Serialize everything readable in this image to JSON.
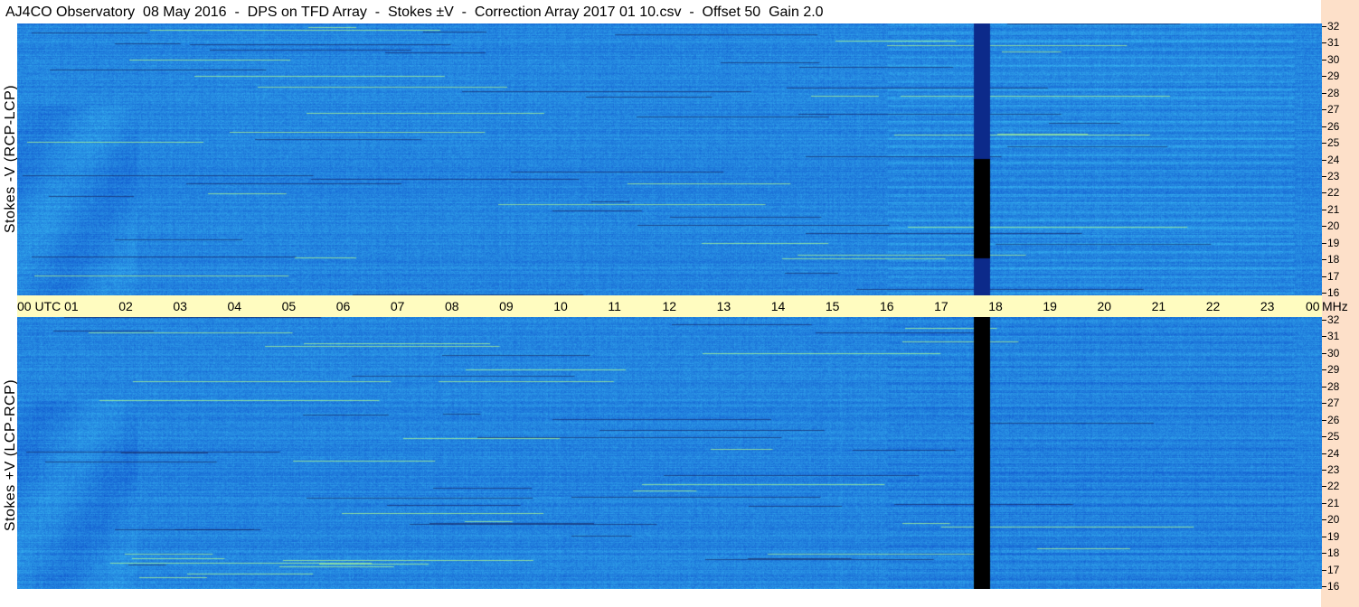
{
  "header": {
    "title": "AJ4CO Observatory  08 May 2016  -  DPS on TFD Array  -  Stokes ±V  -  Correction Array 2017 01 10.csv  -  Offset 50  Gain 2.0"
  },
  "panels": {
    "top_label": "Stokes -V (RCP-LCP)",
    "bottom_label": "Stokes +V (LCP-RCP)"
  },
  "time_axis": {
    "ticks": [
      "00 UTC",
      "01",
      "02",
      "03",
      "04",
      "05",
      "06",
      "07",
      "08",
      "09",
      "10",
      "11",
      "12",
      "13",
      "14",
      "15",
      "16",
      "17",
      "18",
      "19",
      "20",
      "21",
      "22",
      "23",
      "00"
    ],
    "unit_label": "MHz"
  },
  "chart_data": [
    {
      "type": "heatmap",
      "title": "Stokes -V (RCP-LCP)",
      "x": "UTC hours 00-24 (08 May 2016)",
      "y_ticks_mhz": [
        16,
        17,
        18,
        19,
        20,
        21,
        22,
        23,
        24,
        25,
        26,
        27,
        28,
        29,
        30,
        31,
        32
      ],
      "ylim": [
        16,
        32
      ],
      "xlim": [
        0,
        24
      ],
      "colormap": [
        "#000000",
        "#1a5de0",
        "#1f8df5",
        "#28c6ff",
        "#c8ff6a",
        "#ff6a3a"
      ]
    },
    {
      "type": "heatmap",
      "title": "Stokes +V (LCP-RCP)",
      "x": "UTC hours 00-24 (08 May 2016)",
      "y_ticks_mhz": [
        16,
        17,
        18,
        19,
        20,
        21,
        22,
        23,
        24,
        25,
        26,
        27,
        28,
        29,
        30,
        31,
        32
      ],
      "ylim": [
        16,
        32
      ],
      "xlim": [
        0,
        24
      ],
      "colormap": [
        "#000000",
        "#1a5de0",
        "#1f8df5",
        "#28c6ff",
        "#c8ff6a",
        "#ff6a3a"
      ]
    }
  ]
}
